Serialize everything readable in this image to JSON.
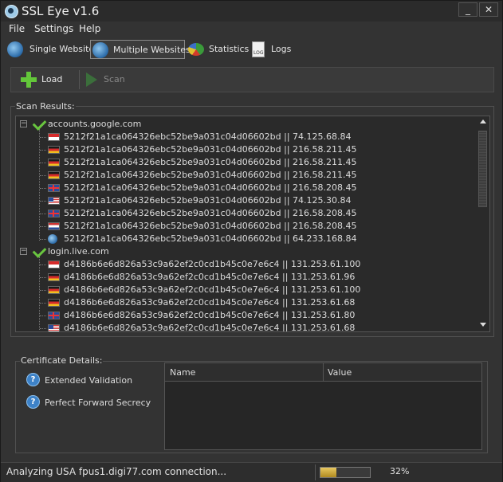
{
  "app": {
    "title": "SSL Eye v1.6"
  },
  "window_controls": {
    "minimize": "_",
    "close": "✕"
  },
  "menu": {
    "items": [
      "File",
      "Settings",
      "Help"
    ]
  },
  "tabs": [
    {
      "label": "Single Website",
      "icon": "globe-icon",
      "active": false
    },
    {
      "label": "Multiple Websites",
      "icon": "globe-icon",
      "active": true
    },
    {
      "label": "Statistics",
      "icon": "pie-chart-icon",
      "active": false
    },
    {
      "label": "Logs",
      "icon": "log-icon",
      "active": false
    }
  ],
  "toolbar": {
    "load_label": "Load",
    "scan_label": "Scan"
  },
  "scan_results": {
    "title": "Scan Results:",
    "groups": [
      {
        "host": "accounts.google.com",
        "expander": "−",
        "entries": [
          {
            "flag": "sg",
            "text": "5212f21a1ca064326ebc52be9a031c04d06602bd || 74.125.68.84"
          },
          {
            "flag": "de",
            "text": "5212f21a1ca064326ebc52be9a031c04d06602bd || 216.58.211.45"
          },
          {
            "flag": "de",
            "text": "5212f21a1ca064326ebc52be9a031c04d06602bd || 216.58.211.45"
          },
          {
            "flag": "de",
            "text": "5212f21a1ca064326ebc52be9a031c04d06602bd || 216.58.211.45"
          },
          {
            "flag": "gb",
            "text": "5212f21a1ca064326ebc52be9a031c04d06602bd || 216.58.208.45"
          },
          {
            "flag": "us",
            "text": "5212f21a1ca064326ebc52be9a031c04d06602bd || 74.125.30.84"
          },
          {
            "flag": "gb",
            "text": "5212f21a1ca064326ebc52be9a031c04d06602bd || 216.58.208.45"
          },
          {
            "flag": "nl",
            "text": "5212f21a1ca064326ebc52be9a031c04d06602bd || 216.58.208.45"
          },
          {
            "flag": "globe",
            "text": "5212f21a1ca064326ebc52be9a031c04d06602bd || 64.233.168.84"
          }
        ]
      },
      {
        "host": "login.live.com",
        "expander": "−",
        "entries": [
          {
            "flag": "sg",
            "text": "d4186b6e6d826a53c9a62ef2c0cd1b45c0e7e6c4 || 131.253.61.100"
          },
          {
            "flag": "de",
            "text": "d4186b6e6d826a53c9a62ef2c0cd1b45c0e7e6c4 || 131.253.61.96"
          },
          {
            "flag": "de",
            "text": "d4186b6e6d826a53c9a62ef2c0cd1b45c0e7e6c4 || 131.253.61.100"
          },
          {
            "flag": "de",
            "text": "d4186b6e6d826a53c9a62ef2c0cd1b45c0e7e6c4 || 131.253.61.68"
          },
          {
            "flag": "gb",
            "text": "d4186b6e6d826a53c9a62ef2c0cd1b45c0e7e6c4 || 131.253.61.80"
          },
          {
            "flag": "us",
            "text": "d4186b6e6d826a53c9a62ef2c0cd1b45c0e7e6c4 || 131.253.61.68"
          }
        ]
      }
    ]
  },
  "certificate": {
    "title": "Certificate Details:",
    "items": [
      {
        "icon": "question-icon",
        "glyph": "?",
        "label": "Extended Validation"
      },
      {
        "icon": "question-icon",
        "glyph": "?",
        "label": "Perfect Forward Secrecy"
      }
    ],
    "columns": [
      "Name",
      "Value"
    ]
  },
  "status": {
    "text": "Analyzing USA fpus1.digi77.com connection...",
    "progress_percent": 32,
    "progress_label": "32%"
  },
  "colors": {
    "accent": "#63c63a",
    "progress": "#d8b040",
    "background": "#333333"
  }
}
